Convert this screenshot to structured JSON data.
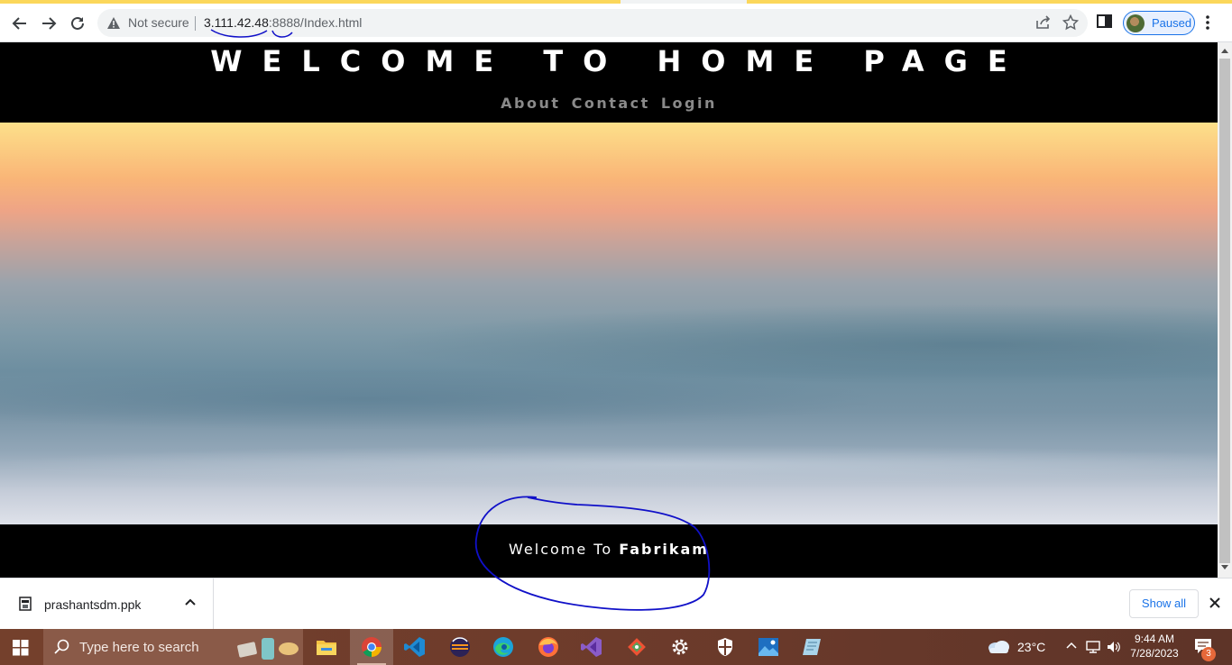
{
  "browser": {
    "security_label": "Not secure",
    "url_host": "3.111.42.48",
    "url_rest": ":8888/Index.html",
    "profile_label": "Paused"
  },
  "site": {
    "title": "WELCOME TO HOME PAGE",
    "nav": [
      "About",
      "Contact",
      "Login"
    ],
    "footer_prefix": "Welcome To",
    "footer_brand": "Fabrikam"
  },
  "downloads": {
    "file_name": "prashantsdm.ppk",
    "show_all_label": "Show all"
  },
  "taskbar": {
    "search_placeholder": "Type here to search",
    "temperature": "23°C",
    "time": "9:44 AM",
    "date": "7/28/2023",
    "notification_count": "3",
    "apps": [
      "file-explorer",
      "chrome",
      "vscode",
      "eclipse",
      "edge",
      "firefox",
      "visual-studio",
      "git",
      "settings",
      "defender",
      "photos",
      "notepad"
    ]
  },
  "colors": {
    "header_bg": "#000000",
    "nav_text": "#8a8a8a",
    "annotation_ink": "#1010c8",
    "taskbar": "#6d3b2b"
  }
}
